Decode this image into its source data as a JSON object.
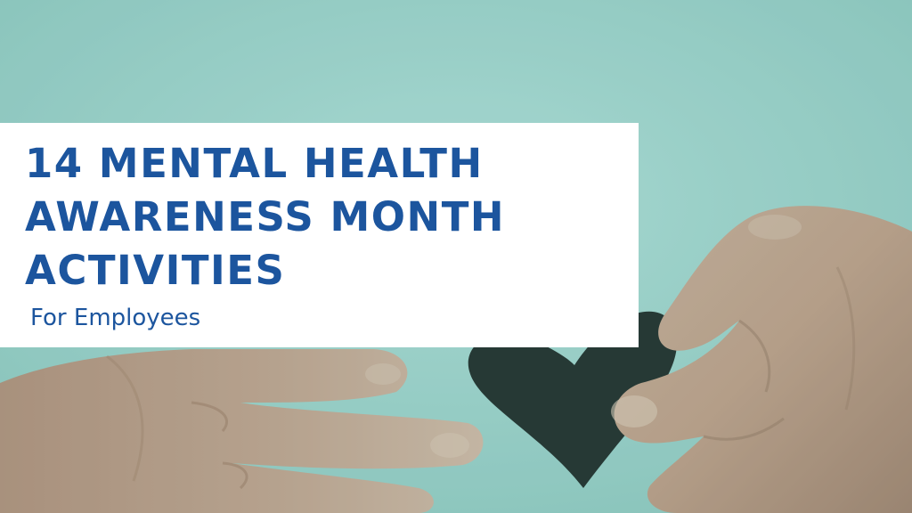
{
  "banner": {
    "title_lines": [
      "14 MENTAL HEALTH",
      "AWARENESS MONTH",
      "ACTIVITIES"
    ],
    "subtitle": "For Employees"
  },
  "colors": {
    "background": "#a6d8d1",
    "panel": "#ffffff",
    "text": "#1c559e",
    "heart": "#1a1f1d",
    "skin": "#c99a80"
  },
  "photo": {
    "subject": "paper-heart-handoff"
  }
}
